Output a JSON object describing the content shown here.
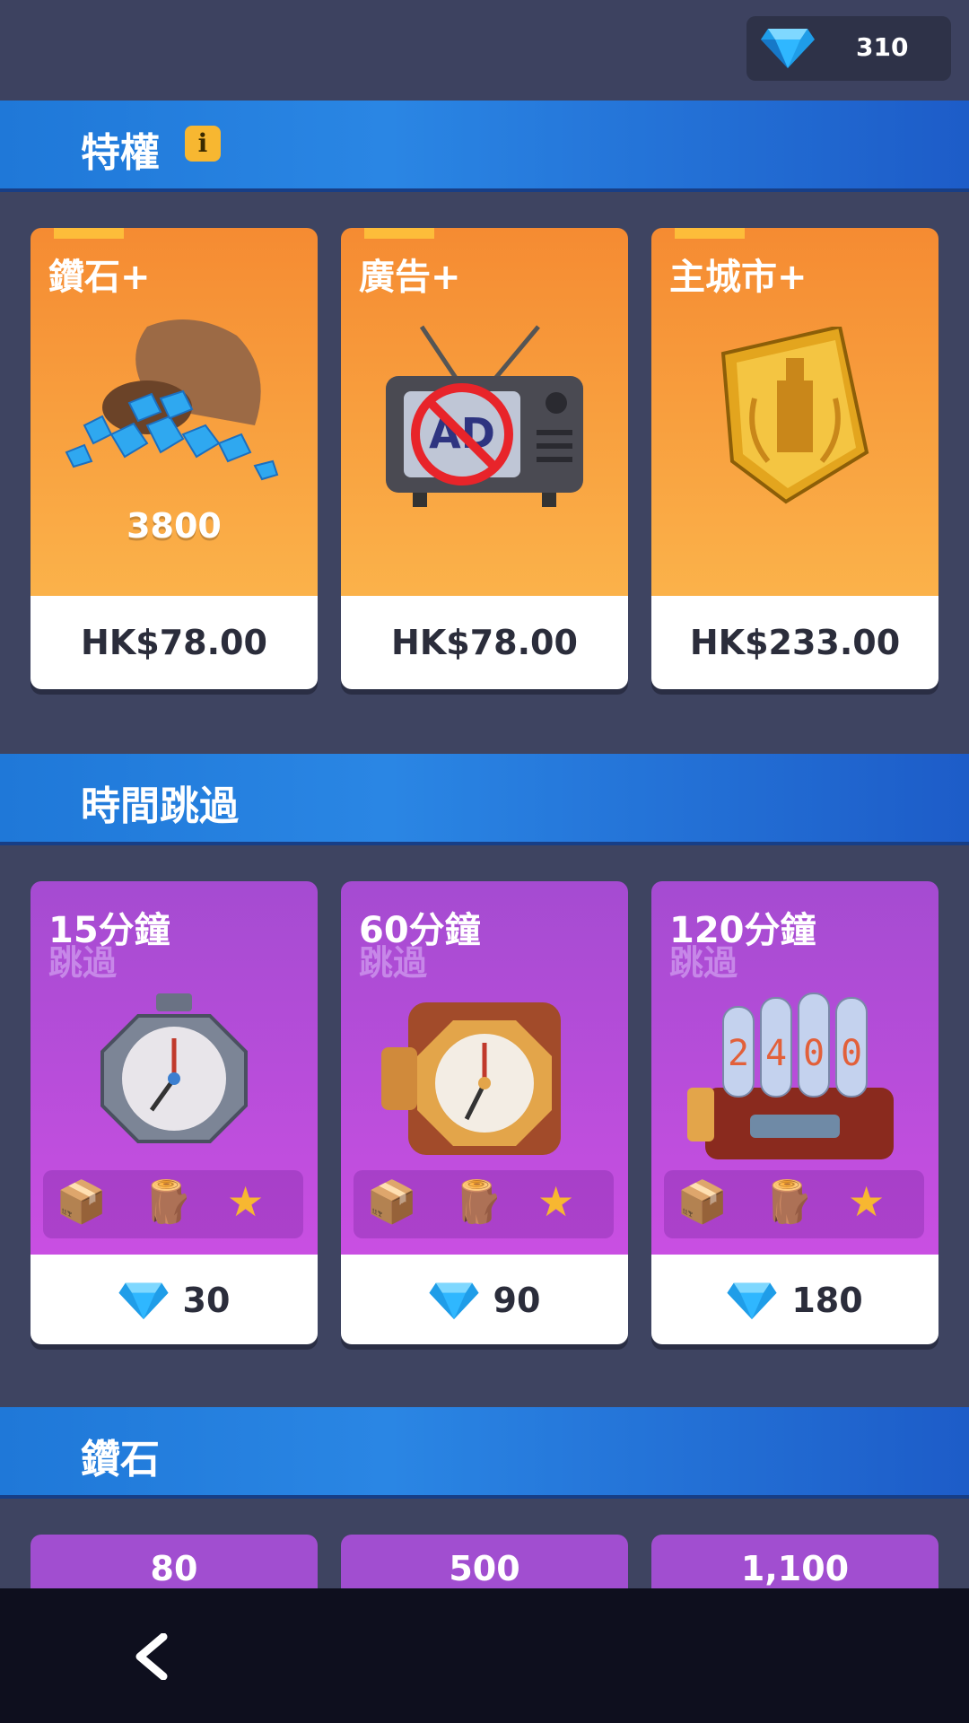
{
  "header": {
    "gem_balance": "310"
  },
  "sections": {
    "privileges": {
      "title": "特權",
      "info": "i",
      "items": [
        {
          "title": "鑽石",
          "amount": "3800",
          "price": "HK$78.00",
          "icon": "gem-sack-icon"
        },
        {
          "title": "廣告",
          "price": "HK$78.00",
          "icon": "no-ads-tv-icon"
        },
        {
          "title": "主城市",
          "price": "HK$233.00",
          "icon": "city-badge-icon"
        }
      ]
    },
    "time_skip": {
      "title": "時間跳過",
      "items": [
        {
          "minutes": "15",
          "unit": "分鐘",
          "sub": "跳過",
          "cost": "30",
          "icon": "stopwatch-icon"
        },
        {
          "minutes": "60",
          "unit": "分鐘",
          "sub": "跳過",
          "cost": "90",
          "icon": "alarm-clock-icon"
        },
        {
          "minutes": "120",
          "unit": "分鐘",
          "sub": "跳過",
          "cost": "180",
          "icon": "nixie-clock-icon"
        }
      ]
    },
    "gems": {
      "title": "鑽石",
      "items": [
        {
          "amount": "80"
        },
        {
          "amount": "500"
        },
        {
          "amount": "1,100"
        }
      ]
    }
  },
  "nav": {
    "back": "‹"
  },
  "colors": {
    "privilege_card": "#f58b32",
    "skip_card": "#b34dd8",
    "header_blue": "#1f78d8",
    "gem": "#2aa8f5"
  }
}
